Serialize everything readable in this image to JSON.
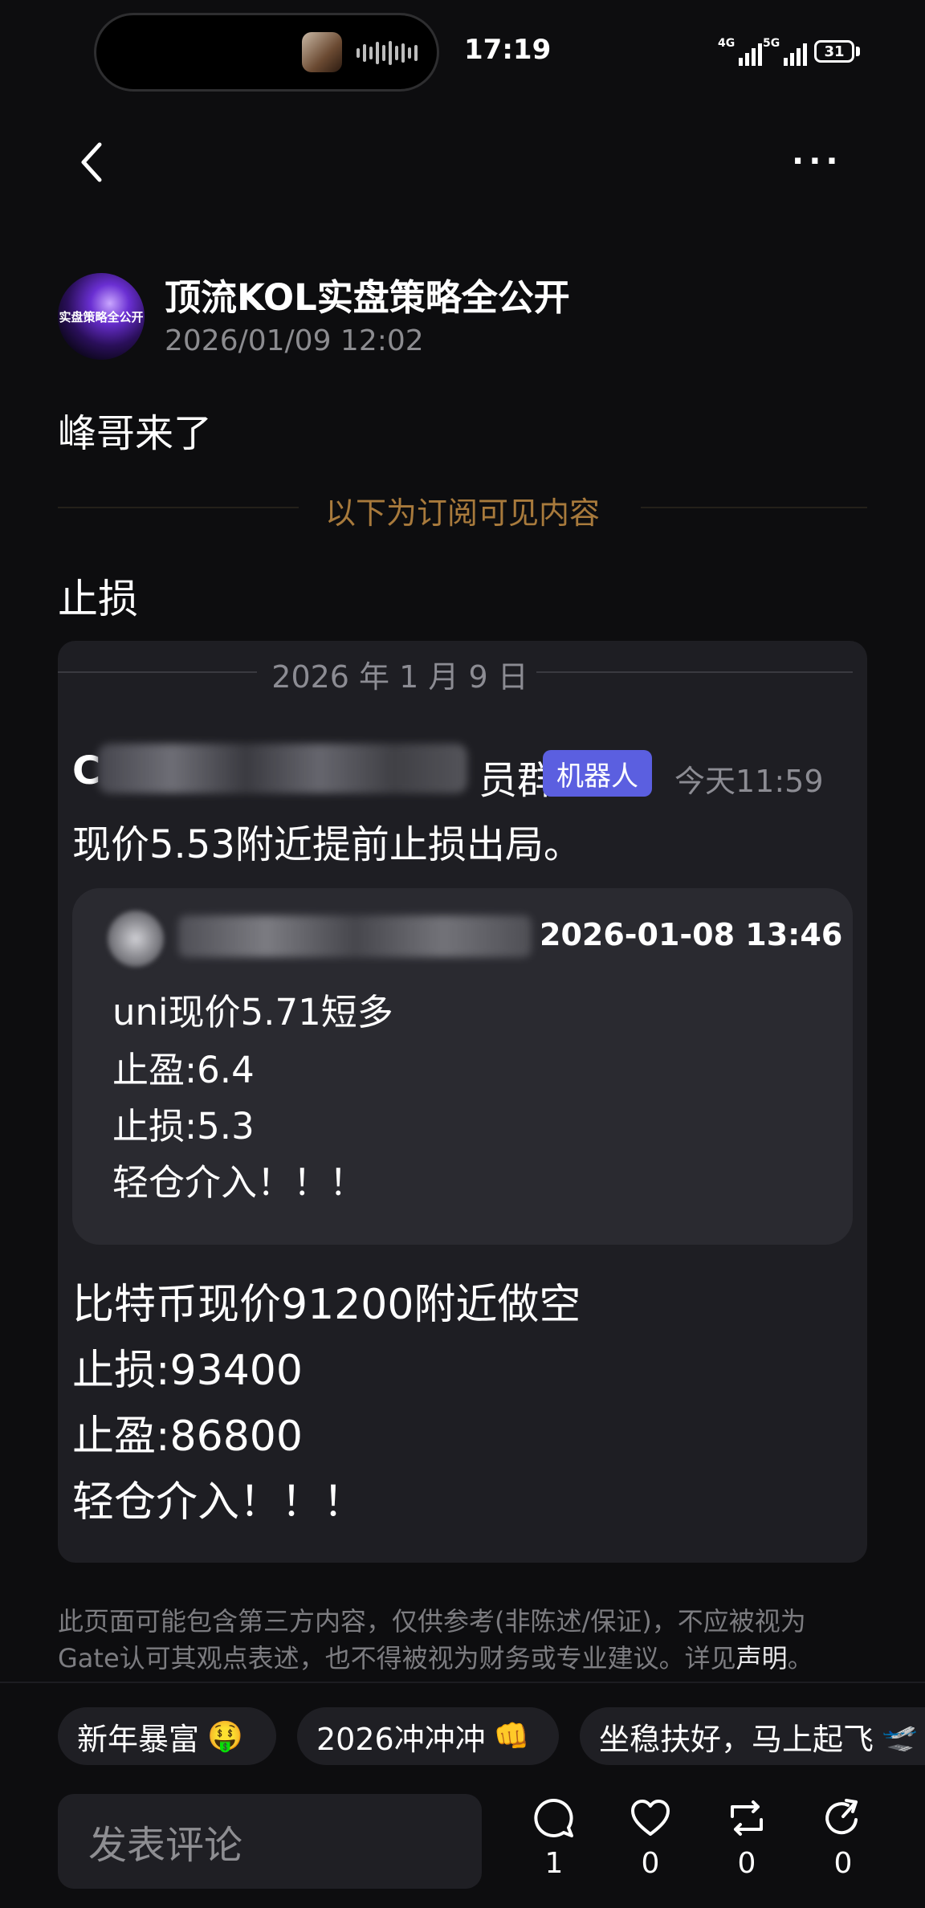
{
  "status_bar": {
    "time": "17:19",
    "signal1": "4G",
    "signal2": "5G",
    "battery": "31"
  },
  "header": {
    "more_label": "···"
  },
  "post": {
    "avatar_text": "实盘策略全公开",
    "author": "顶流KOL实盘策略全公开",
    "timestamp": "2026/01/09 12:02",
    "text": "峰哥来了",
    "subscriber_divider": "以下为订阅可见内容",
    "section_title": "止损"
  },
  "card": {
    "date": "2026 年 1 月 9 日",
    "sender_prefix": "C",
    "sender_suffix": "员群",
    "bot_badge": "机器人",
    "time": "今天11:59",
    "message": "现价5.53附近提前止损出局。",
    "quote": {
      "time": "2026-01-08 13:46",
      "lines": [
        "uni现价5.71短多",
        "止盈:6.4",
        "止损:5.3",
        "轻仓介入！！！"
      ]
    },
    "lines": [
      "比特币现价91200附近做空",
      "止损:93400",
      "止盈:86800",
      "轻仓介入！！！"
    ]
  },
  "disclaimer": {
    "line1": "此页面可能包含第三方内容，仅供参考(非陈述/保证)，不应被视为",
    "line2": "Gate认可其观点表述，也不得被视为财务或专业建议。详见",
    "link": "声明",
    "end": "。"
  },
  "chips": [
    {
      "label": "新年暴富",
      "emoji": "🤑"
    },
    {
      "label": "2026冲冲冲",
      "emoji": "👊"
    },
    {
      "label": "坐稳扶好，马上起飞",
      "emoji": "🛫"
    }
  ],
  "footer": {
    "comment_placeholder": "发表评论",
    "actions": [
      {
        "name": "comment",
        "count": "1"
      },
      {
        "name": "like",
        "count": "0"
      },
      {
        "name": "repost",
        "count": "0"
      },
      {
        "name": "share",
        "count": "0"
      }
    ]
  },
  "icons": [
    "back-arrow-icon",
    "more-icon",
    "comment-icon",
    "heart-icon",
    "repost-icon",
    "share-icon"
  ],
  "colors": {
    "background": "#0d0d0f",
    "card": "#1e1e23",
    "accent_gold": "#a87a3c",
    "bot_badge": "#5b5fe0"
  }
}
